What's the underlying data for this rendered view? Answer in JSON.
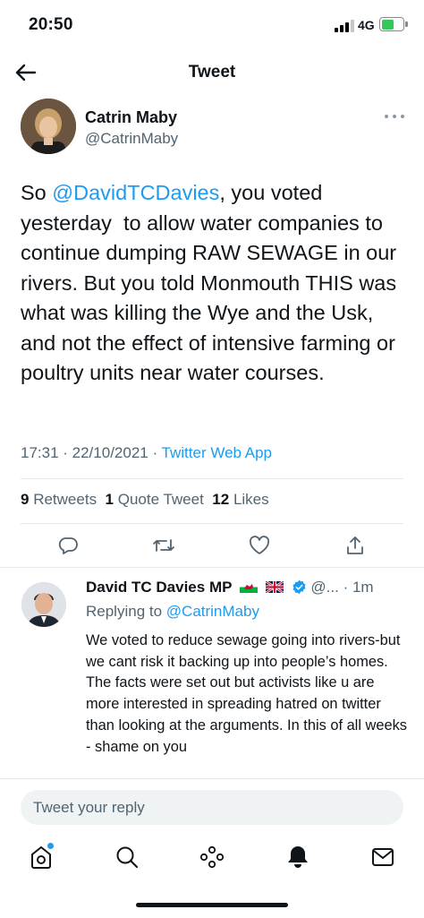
{
  "status_bar": {
    "time": "20:50",
    "network": "4G"
  },
  "header": {
    "title": "Tweet"
  },
  "tweet": {
    "author_name": "Catrin Maby",
    "author_handle": "@CatrinMaby",
    "text_prefix": "So ",
    "mention": "@DavidTCDavies",
    "text_body": ", you voted yesterday  to allow water companies to continue dumping RAW SEWAGE in our rivers. But you told Monmouth THIS was what was killing the Wye and the Usk, and not the effect of intensive farming or poultry units near water courses.",
    "timestamp": "17:31 · 22/10/2021 · ",
    "source": "Twitter Web App"
  },
  "stats": {
    "retweets_count": "9",
    "retweets_label": "Retweets",
    "quote_count": "1",
    "quote_label": "Quote Tweet",
    "likes_count": "12",
    "likes_label": "Likes"
  },
  "reply": {
    "name": "David TC Davies MP",
    "handle": "@...",
    "time": "· 1m",
    "replying_to_label": "Replying to ",
    "replying_to_handle": "@CatrinMaby",
    "text": "We voted to reduce sewage going into rivers-but we cant risk it backing up into people’s homes. The facts were set out but activists like u are more interested in spreading hatred on twitter than looking at the arguments. In this of all weeks - shame on you"
  },
  "composer": {
    "placeholder": "Tweet your reply"
  },
  "colors": {
    "accent": "#1d9bf0",
    "text_primary": "#0f1419",
    "text_secondary": "#536471",
    "verified_badge": "#1d9bf0",
    "battery": "#34c759"
  },
  "icons": {
    "back": "arrow-left-icon",
    "more": "more-dots-icon",
    "reply": "reply-bubble-icon",
    "retweet": "retweet-icon",
    "like": "heart-icon",
    "share": "share-icon",
    "home": "home-icon",
    "search": "search-icon",
    "spaces": "spaces-icon",
    "notifications": "bell-icon",
    "messages": "mail-icon"
  }
}
